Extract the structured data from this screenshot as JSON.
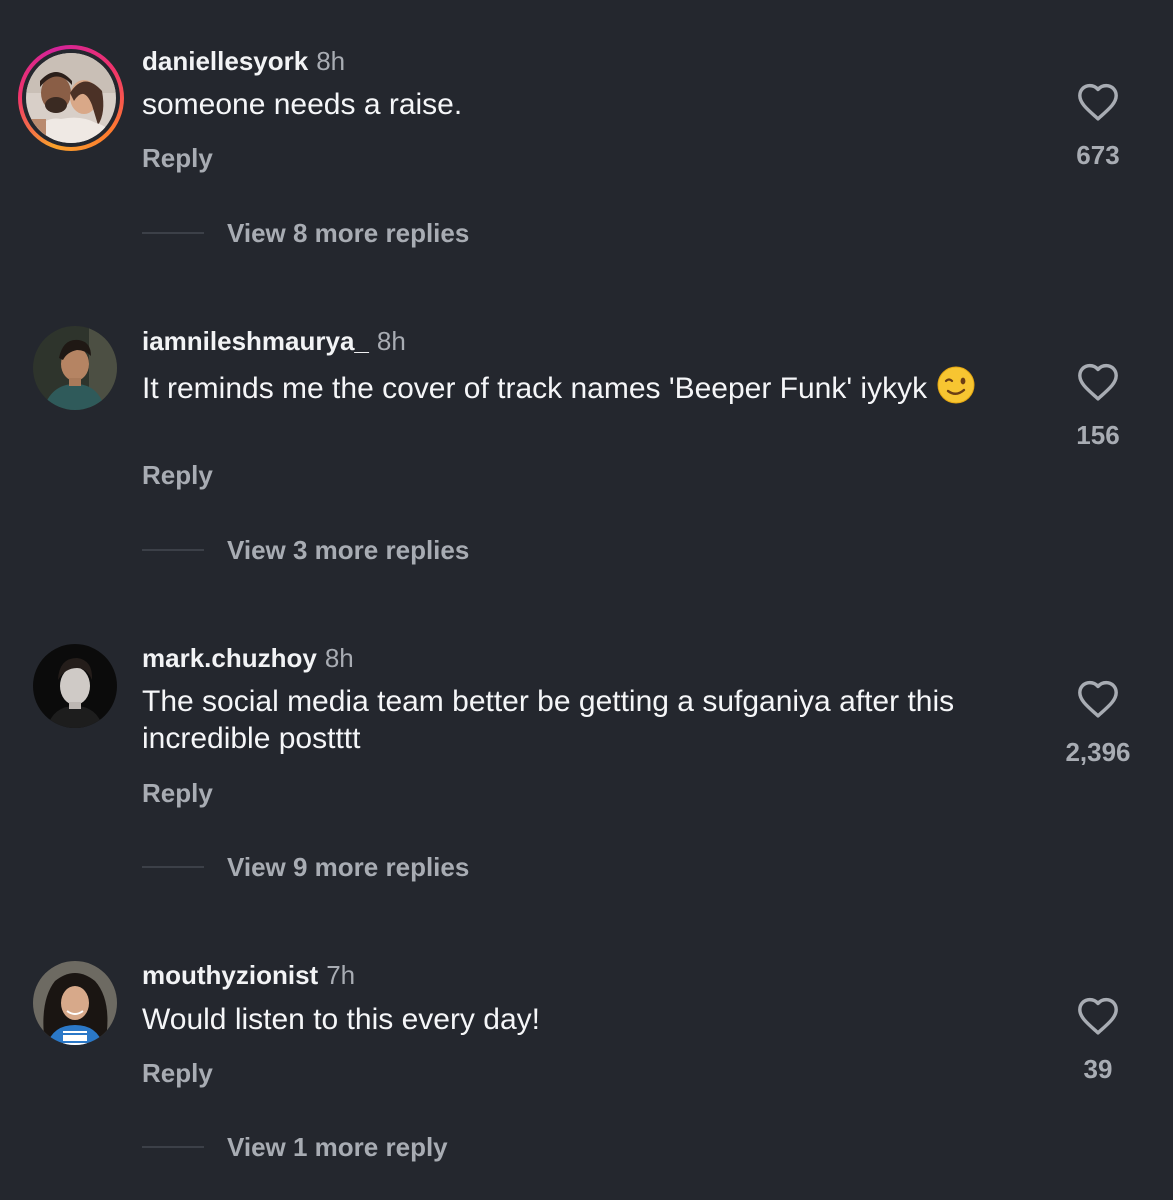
{
  "comments": [
    {
      "username": "daniellesyork",
      "time": "8h",
      "text": "someone needs a raise.",
      "emoji": "",
      "reply_label": "Reply",
      "view_replies": "View 8 more replies",
      "likes": "673",
      "has_story_ring": true
    },
    {
      "username": "iamnileshmaurya_",
      "time": "8h",
      "text": "It reminds me the cover of track names 'Beeper Funk' iykyk",
      "emoji": "winking-face",
      "reply_label": "Reply",
      "view_replies": "View 3 more replies",
      "likes": "156",
      "has_story_ring": false
    },
    {
      "username": "mark.chuzhoy",
      "time": "8h",
      "text": "The social media team better be getting a sufganiya after this incredible postttt",
      "emoji": "",
      "reply_label": "Reply",
      "view_replies": "View 9 more replies",
      "likes": "2,396",
      "has_story_ring": false
    },
    {
      "username": "mouthyzionist",
      "time": "7h",
      "text": "Would listen to this every day!",
      "emoji": "",
      "reply_label": "Reply",
      "view_replies": "View 1 more reply",
      "likes": "39",
      "has_story_ring": false
    }
  ],
  "colors": {
    "background": "#24272e",
    "primary_text": "#f2f3f5",
    "secondary_text": "#a8acb3",
    "story_ring": "#f0336b"
  },
  "icons": {
    "like": "heart-outline-icon",
    "emoji": "winking-face-emoji"
  }
}
